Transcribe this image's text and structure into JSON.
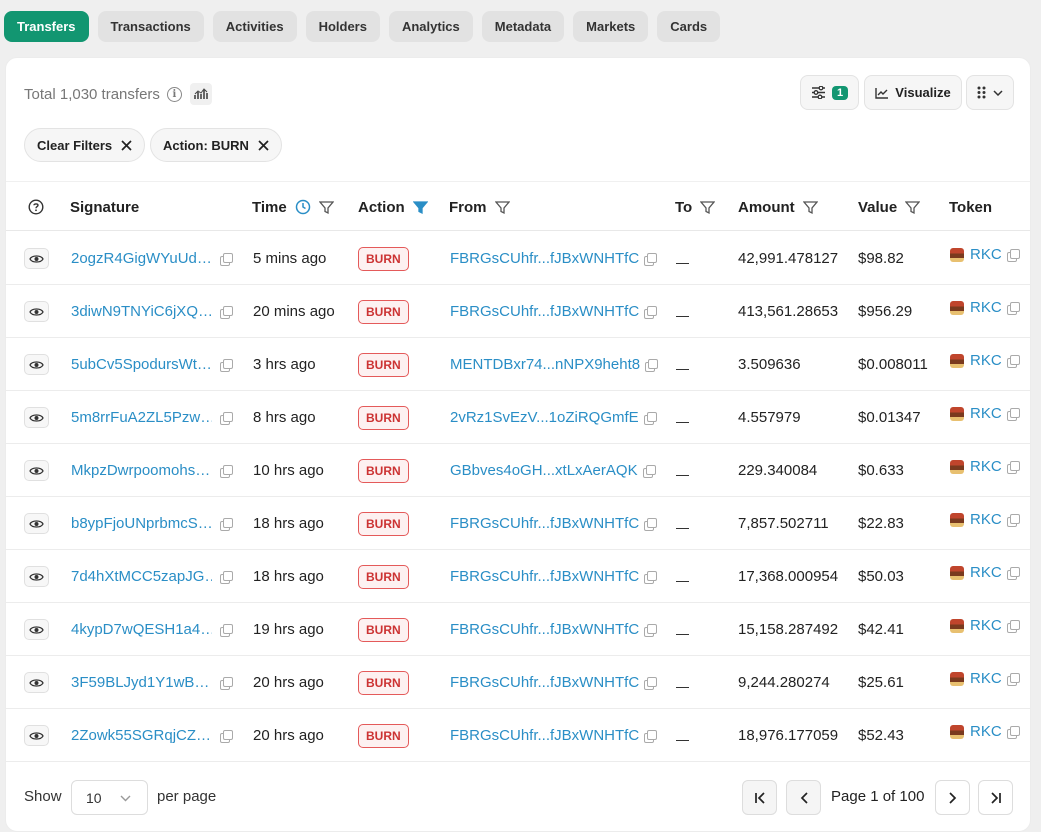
{
  "tabs": [
    {
      "label": "Transfers",
      "active": true
    },
    {
      "label": "Transactions"
    },
    {
      "label": "Activities"
    },
    {
      "label": "Holders"
    },
    {
      "label": "Analytics"
    },
    {
      "label": "Metadata"
    },
    {
      "label": "Markets"
    },
    {
      "label": "Cards"
    }
  ],
  "toolbar": {
    "total": "Total 1,030 transfers",
    "filter_count": "1",
    "visualize": "Visualize"
  },
  "chips": [
    {
      "label": "Clear Filters"
    },
    {
      "label": "Action: BURN"
    }
  ],
  "columns": {
    "signature": "Signature",
    "time": "Time",
    "action": "Action",
    "from": "From",
    "to": "To",
    "amount": "Amount",
    "value": "Value",
    "token": "Token"
  },
  "rows": [
    {
      "signature": "2ogzR4GigWYuUd…",
      "time": "5 mins ago",
      "action": "BURN",
      "from": "FBRGsCUhfr...fJBxWNHTfC",
      "to": "__",
      "amount": "42,991.478127",
      "value": "$98.82",
      "token": "RKC"
    },
    {
      "signature": "3diwN9TNYiC6jXQ…",
      "time": "20 mins ago",
      "action": "BURN",
      "from": "FBRGsCUhfr...fJBxWNHTfC",
      "to": "__",
      "amount": "413,561.28653",
      "value": "$956.29",
      "token": "RKC"
    },
    {
      "signature": "5ubCv5SpodursWt…",
      "time": "3 hrs ago",
      "action": "BURN",
      "from": "MENTDBxr74...nNPX9heht8",
      "to": "__",
      "amount": "3.509636",
      "value": "$0.008011",
      "token": "RKC"
    },
    {
      "signature": "5m8rrFuA2ZL5Pzw…",
      "time": "8 hrs ago",
      "action": "BURN",
      "from": "2vRz1SvEzV...1oZiRQGmfE",
      "to": "__",
      "amount": "4.557979",
      "value": "$0.01347",
      "token": "RKC"
    },
    {
      "signature": "MkpzDwrpoomohs…",
      "time": "10 hrs ago",
      "action": "BURN",
      "from": "GBbves4oGH...xtLxAerAQK",
      "to": "__",
      "amount": "229.340084",
      "value": "$0.633",
      "token": "RKC"
    },
    {
      "signature": "b8ypFjoUNprbmcS…",
      "time": "18 hrs ago",
      "action": "BURN",
      "from": "FBRGsCUhfr...fJBxWNHTfC",
      "to": "__",
      "amount": "7,857.502711",
      "value": "$22.83",
      "token": "RKC"
    },
    {
      "signature": "7d4hXtMCC5zapJG…",
      "time": "18 hrs ago",
      "action": "BURN",
      "from": "FBRGsCUhfr...fJBxWNHTfC",
      "to": "__",
      "amount": "17,368.000954",
      "value": "$50.03",
      "token": "RKC"
    },
    {
      "signature": "4kypD7wQESH1a4…",
      "time": "19 hrs ago",
      "action": "BURN",
      "from": "FBRGsCUhfr...fJBxWNHTfC",
      "to": "__",
      "amount": "15,158.287492",
      "value": "$42.41",
      "token": "RKC"
    },
    {
      "signature": "3F59BLJyd1Y1wB…",
      "time": "20 hrs ago",
      "action": "BURN",
      "from": "FBRGsCUhfr...fJBxWNHTfC",
      "to": "__",
      "amount": "9,244.280274",
      "value": "$25.61",
      "token": "RKC"
    },
    {
      "signature": "2Zowk55SGRqjCZ…",
      "time": "20 hrs ago",
      "action": "BURN",
      "from": "FBRGsCUhfr...fJBxWNHTfC",
      "to": "__",
      "amount": "18,976.177059",
      "value": "$52.43",
      "token": "RKC"
    }
  ],
  "footer": {
    "show": "Show",
    "per_page_value": "10",
    "per_page": "per page",
    "page_info": "Page 1 of 100"
  },
  "colors": {
    "accent": "#129671",
    "link": "#2a8ec6",
    "burn": "#c33"
  }
}
